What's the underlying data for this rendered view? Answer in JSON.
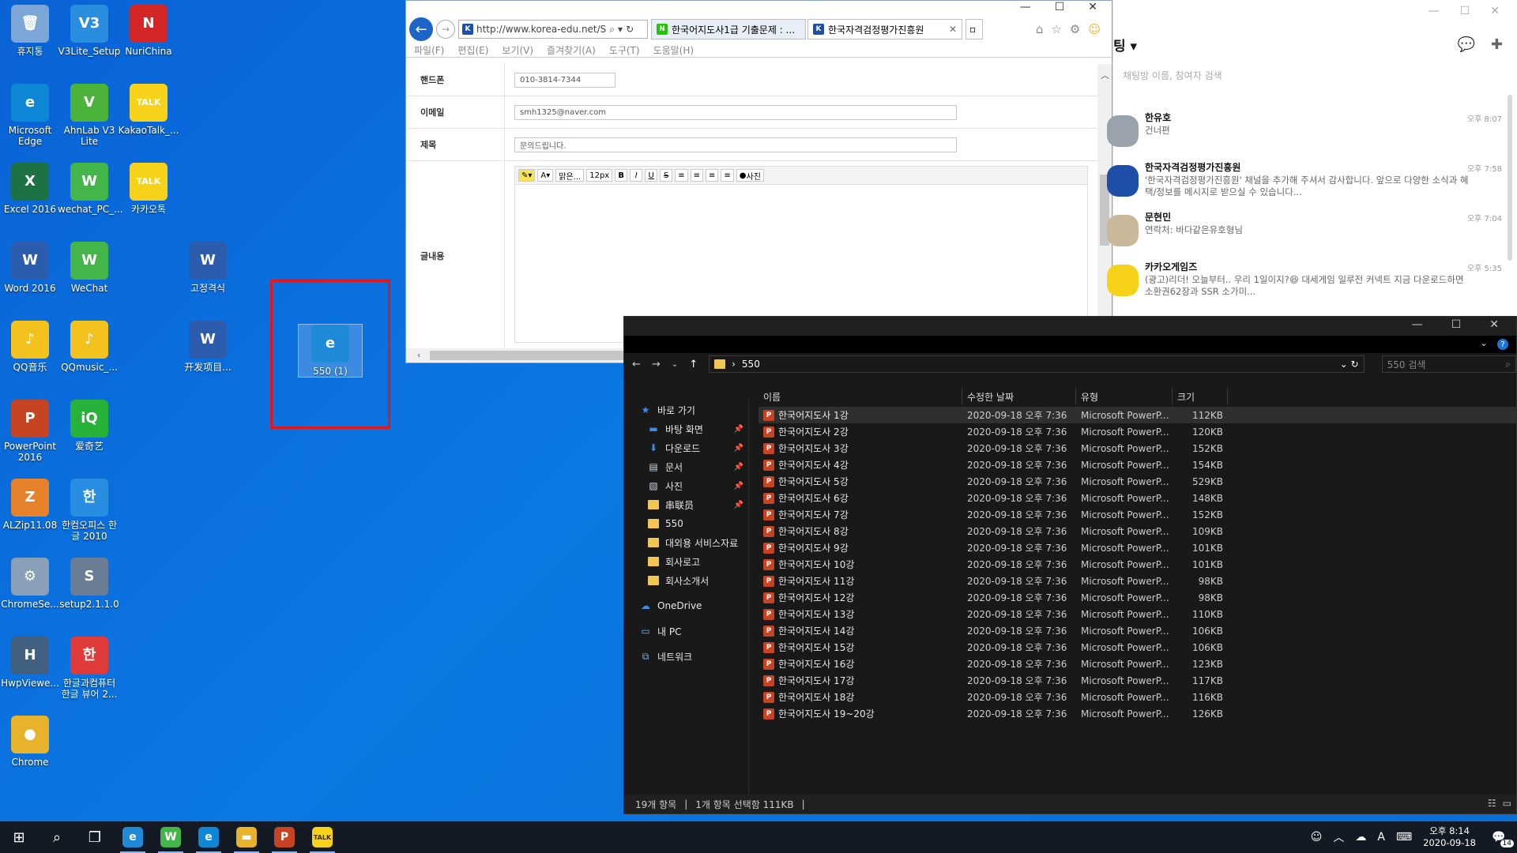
{
  "desktop": {
    "icons": [
      {
        "label": "휴지통",
        "glyph": "🗑",
        "color": "#7aa7d6"
      },
      {
        "label": "V3Lite_Setup",
        "glyph": "V3",
        "color": "#2a8ee0"
      },
      {
        "label": "NuriChina",
        "glyph": "N",
        "color": "#d32727"
      },
      {
        "label": "Microsoft Edge",
        "glyph": "e",
        "color": "#0e88d6"
      },
      {
        "label": "AhnLab V3 Lite",
        "glyph": "V",
        "color": "#4bb33a"
      },
      {
        "label": "KakaoTalk_...",
        "glyph": "TALK",
        "color": "#f6d21a"
      },
      {
        "label": "Excel 2016",
        "glyph": "X",
        "color": "#1d7244"
      },
      {
        "label": "wechat_PC_...",
        "glyph": "W",
        "color": "#44b549"
      },
      {
        "label": "카카오톡",
        "glyph": "TALK",
        "color": "#f6d21a"
      },
      {
        "label": "Word 2016",
        "glyph": "W",
        "color": "#2b5cad"
      },
      {
        "label": "WeChat",
        "glyph": "W",
        "color": "#44b549"
      },
      {
        "label": "고정격식",
        "glyph": "W",
        "color": "#2b5cad"
      },
      {
        "label": "QQ音乐",
        "glyph": "♪",
        "color": "#f3c21c"
      },
      {
        "label": "QQmusic_...",
        "glyph": "♪",
        "color": "#f3c21c"
      },
      {
        "label": "开发项目...",
        "glyph": "W",
        "color": "#2b5cad"
      },
      {
        "label": "PowerPoint 2016",
        "glyph": "P",
        "color": "#c74423"
      },
      {
        "label": "爱奇艺",
        "glyph": "iQ",
        "color": "#27b23a"
      },
      {
        "label": "ALZip11.08",
        "glyph": "Z",
        "color": "#e8822a"
      },
      {
        "label": "한컴오피스 한글 2010",
        "glyph": "한",
        "color": "#2a8ee0"
      },
      {
        "label": "ChromeSe...",
        "glyph": "⚙",
        "color": "#8aa0b8"
      },
      {
        "label": "setup2.1.1.0",
        "glyph": "S",
        "color": "#6b7c95"
      },
      {
        "label": "HwpViewe...",
        "glyph": "H",
        "color": "#41607f"
      },
      {
        "label": "한글과컴퓨터 한글 뷰어 2...",
        "glyph": "한",
        "color": "#e03b3b"
      },
      {
        "label": "Chrome",
        "glyph": "●",
        "color": "#e8b32a"
      },
      {
        "label": "550 (1)",
        "glyph": "e",
        "color": "#1e8ad8"
      }
    ]
  },
  "browser": {
    "url": "http://www.korea-edu.net/S",
    "tabs": [
      {
        "label": "한국어지도사1급 기출문제 : ...",
        "favicon": "N",
        "color": "#1ec800"
      },
      {
        "label": "한국자격검정평가진흥원",
        "favicon": "K",
        "color": "#1d4fa8"
      }
    ],
    "menu": [
      "파일(F)",
      "편집(E)",
      "보기(V)",
      "즐겨찾기(A)",
      "도구(T)",
      "도움말(H)"
    ],
    "form": {
      "phone_label": "핸드폰",
      "phone_value": "010-3814-7344",
      "email_label": "이메일",
      "email_value": "smh1325@naver.com",
      "subject_label": "제목",
      "subject_value": "문의드립니다.",
      "content_label": "글내용",
      "font_name": "맑은...",
      "font_size": "12px",
      "photo_label": "사진"
    }
  },
  "kakao": {
    "title": "팅 ▾",
    "search_placeholder": "채팅방 이름, 참여자 검색",
    "chats": [
      {
        "name": "한유호",
        "msg": "건너편",
        "time": "오후 8:07",
        "color": "#9aa3ad"
      },
      {
        "name": "한국자격검정평가진흥원",
        "msg": "'한국자격검정평가진흥원' 채널을 추가해 주셔서 감사합니다. 앞으로 다양한 소식과 혜택/정보를 메시지로 받으실 수 있습니다...",
        "time": "오후 7:58",
        "color": "#1d4fa8"
      },
      {
        "name": "문현민",
        "msg": "연락처: 바다같은유호형님",
        "time": "오후 7:04",
        "color": "#c9b99a"
      },
      {
        "name": "카카오게임즈",
        "msg": "(광고)리더! 오늘부터.. 우리 1일이지?😆 대세게임 일루전 커넥트 지금 다운로드하면 소환권62장과 SSR 소가미...",
        "time": "오후 5:35",
        "color": "#f6d21a"
      }
    ]
  },
  "explorer": {
    "path": "550",
    "search_placeholder": "550 검색",
    "columns": {
      "name": "이름",
      "date": "수정한 날짜",
      "type": "유형",
      "size": "크기"
    },
    "sidebar": [
      {
        "label": "바로 가기",
        "kind": "star",
        "pinned": false
      },
      {
        "label": "바탕 화면",
        "kind": "desktop",
        "pinned": true
      },
      {
        "label": "다운로드",
        "kind": "download",
        "pinned": true
      },
      {
        "label": "문서",
        "kind": "doc",
        "pinned": true
      },
      {
        "label": "사진",
        "kind": "pic",
        "pinned": true
      },
      {
        "label": "串联员",
        "kind": "folder",
        "pinned": true
      },
      {
        "label": "550",
        "kind": "folder",
        "pinned": false
      },
      {
        "label": "대외용 서비스자료",
        "kind": "folder",
        "pinned": false
      },
      {
        "label": "회사로고",
        "kind": "folder",
        "pinned": false
      },
      {
        "label": "회사소개서",
        "kind": "folder",
        "pinned": false
      },
      {
        "label": "OneDrive",
        "kind": "cloud",
        "pinned": false
      },
      {
        "label": "내 PC",
        "kind": "pc",
        "pinned": false
      },
      {
        "label": "네트워크",
        "kind": "net",
        "pinned": false
      }
    ],
    "files": [
      {
        "name": "한국어지도사 1강",
        "date": "2020-09-18 오후 7:36",
        "type": "Microsoft PowerP...",
        "size": "112KB",
        "selected": true
      },
      {
        "name": "한국어지도사 2강",
        "date": "2020-09-18 오후 7:36",
        "type": "Microsoft PowerP...",
        "size": "120KB"
      },
      {
        "name": "한국어지도사 3강",
        "date": "2020-09-18 오후 7:36",
        "type": "Microsoft PowerP...",
        "size": "152KB"
      },
      {
        "name": "한국어지도사 4강",
        "date": "2020-09-18 오후 7:36",
        "type": "Microsoft PowerP...",
        "size": "154KB"
      },
      {
        "name": "한국어지도사 5강",
        "date": "2020-09-18 오후 7:36",
        "type": "Microsoft PowerP...",
        "size": "529KB"
      },
      {
        "name": "한국어지도사 6강",
        "date": "2020-09-18 오후 7:36",
        "type": "Microsoft PowerP...",
        "size": "148KB"
      },
      {
        "name": "한국어지도사 7강",
        "date": "2020-09-18 오후 7:36",
        "type": "Microsoft PowerP...",
        "size": "152KB"
      },
      {
        "name": "한국어지도사 8강",
        "date": "2020-09-18 오후 7:36",
        "type": "Microsoft PowerP...",
        "size": "109KB"
      },
      {
        "name": "한국어지도사 9강",
        "date": "2020-09-18 오후 7:36",
        "type": "Microsoft PowerP...",
        "size": "101KB"
      },
      {
        "name": "한국어지도사 10강",
        "date": "2020-09-18 오후 7:36",
        "type": "Microsoft PowerP...",
        "size": "101KB"
      },
      {
        "name": "한국어지도사 11강",
        "date": "2020-09-18 오후 7:36",
        "type": "Microsoft PowerP...",
        "size": "98KB"
      },
      {
        "name": "한국어지도사 12강",
        "date": "2020-09-18 오후 7:36",
        "type": "Microsoft PowerP...",
        "size": "98KB"
      },
      {
        "name": "한국어지도사 13강",
        "date": "2020-09-18 오후 7:36",
        "type": "Microsoft PowerP...",
        "size": "110KB"
      },
      {
        "name": "한국어지도사 14강",
        "date": "2020-09-18 오후 7:36",
        "type": "Microsoft PowerP...",
        "size": "106KB"
      },
      {
        "name": "한국어지도사 15강",
        "date": "2020-09-18 오후 7:36",
        "type": "Microsoft PowerP...",
        "size": "106KB"
      },
      {
        "name": "한국어지도사 16강",
        "date": "2020-09-18 오후 7:36",
        "type": "Microsoft PowerP...",
        "size": "123KB"
      },
      {
        "name": "한국어지도사 17강",
        "date": "2020-09-18 오후 7:36",
        "type": "Microsoft PowerP...",
        "size": "117KB"
      },
      {
        "name": "한국어지도사 18강",
        "date": "2020-09-18 오후 7:36",
        "type": "Microsoft PowerP...",
        "size": "116KB"
      },
      {
        "name": "한국어지도사 19~20강",
        "date": "2020-09-18 오후 7:36",
        "type": "Microsoft PowerP...",
        "size": "126KB"
      }
    ],
    "status_count": "19개 항목",
    "status_selected": "1개 항목 선택함 111KB"
  },
  "taskbar": {
    "apps": [
      {
        "name": "ie",
        "glyph": "e",
        "color": "#1e8ad8"
      },
      {
        "name": "wechat",
        "glyph": "W",
        "color": "#44b549"
      },
      {
        "name": "edge",
        "glyph": "e",
        "color": "#0e88d6"
      },
      {
        "name": "explorer",
        "glyph": "▬",
        "color": "#e8b32a"
      },
      {
        "name": "powerpoint",
        "glyph": "P",
        "color": "#c74423"
      },
      {
        "name": "kakaotalk",
        "glyph": "TALK",
        "color": "#f6d21a"
      }
    ],
    "time": "오후 8:14",
    "date": "2020-09-18",
    "ime": "A",
    "notifications": "14"
  }
}
